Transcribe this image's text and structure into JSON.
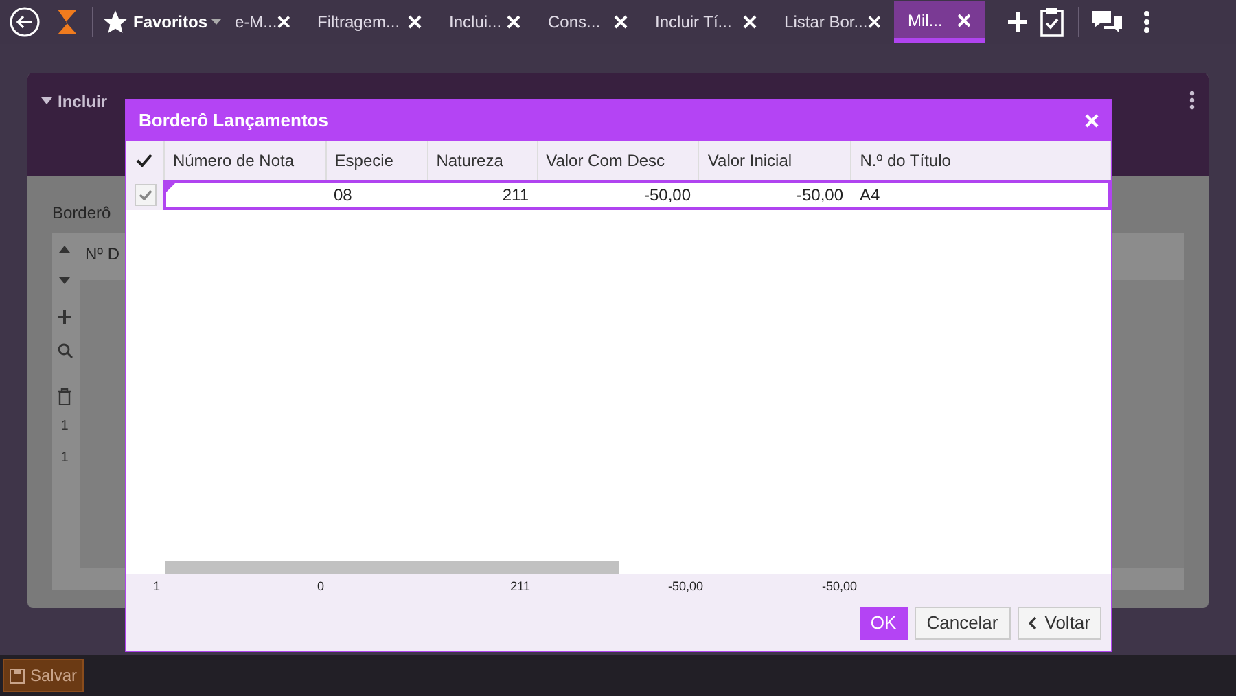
{
  "top_bar": {
    "favorites": "Favoritos",
    "tabs": [
      {
        "label": "e-M...",
        "selected": false
      },
      {
        "label": "Filtragem...",
        "selected": false
      },
      {
        "label": "Inclui...",
        "selected": false
      },
      {
        "label": "Cons...",
        "selected": false
      },
      {
        "label": "Incluir Tí...",
        "selected": false
      },
      {
        "label": "Listar Bor...",
        "selected": false
      },
      {
        "label": "Mil...",
        "selected": true
      }
    ]
  },
  "panel": {
    "title": "Incluir",
    "section_label": "Borderô",
    "grid_header": "Nº D",
    "row_numbers": [
      "1",
      "1"
    ]
  },
  "dialog": {
    "title": "Borderô Lançamentos",
    "columns": [
      "Número de Nota",
      "Especie",
      "Natureza",
      "Valor Com Desc",
      "Valor Inicial",
      "N.º do Título"
    ],
    "rows": [
      {
        "checked": true,
        "selected": true,
        "cells": [
          "",
          "08",
          "211",
          "-50,00",
          "-50,00",
          "A4"
        ]
      }
    ],
    "totals": [
      "1",
      "0",
      "211",
      "-50,00",
      "-50,00"
    ],
    "buttons": [
      {
        "label": "OK",
        "kind": "primary"
      },
      {
        "label": "Cancelar",
        "kind": "plain"
      },
      {
        "label": "Voltar",
        "kind": "back"
      }
    ]
  },
  "bottom_bar": {
    "save": "Salvar"
  }
}
